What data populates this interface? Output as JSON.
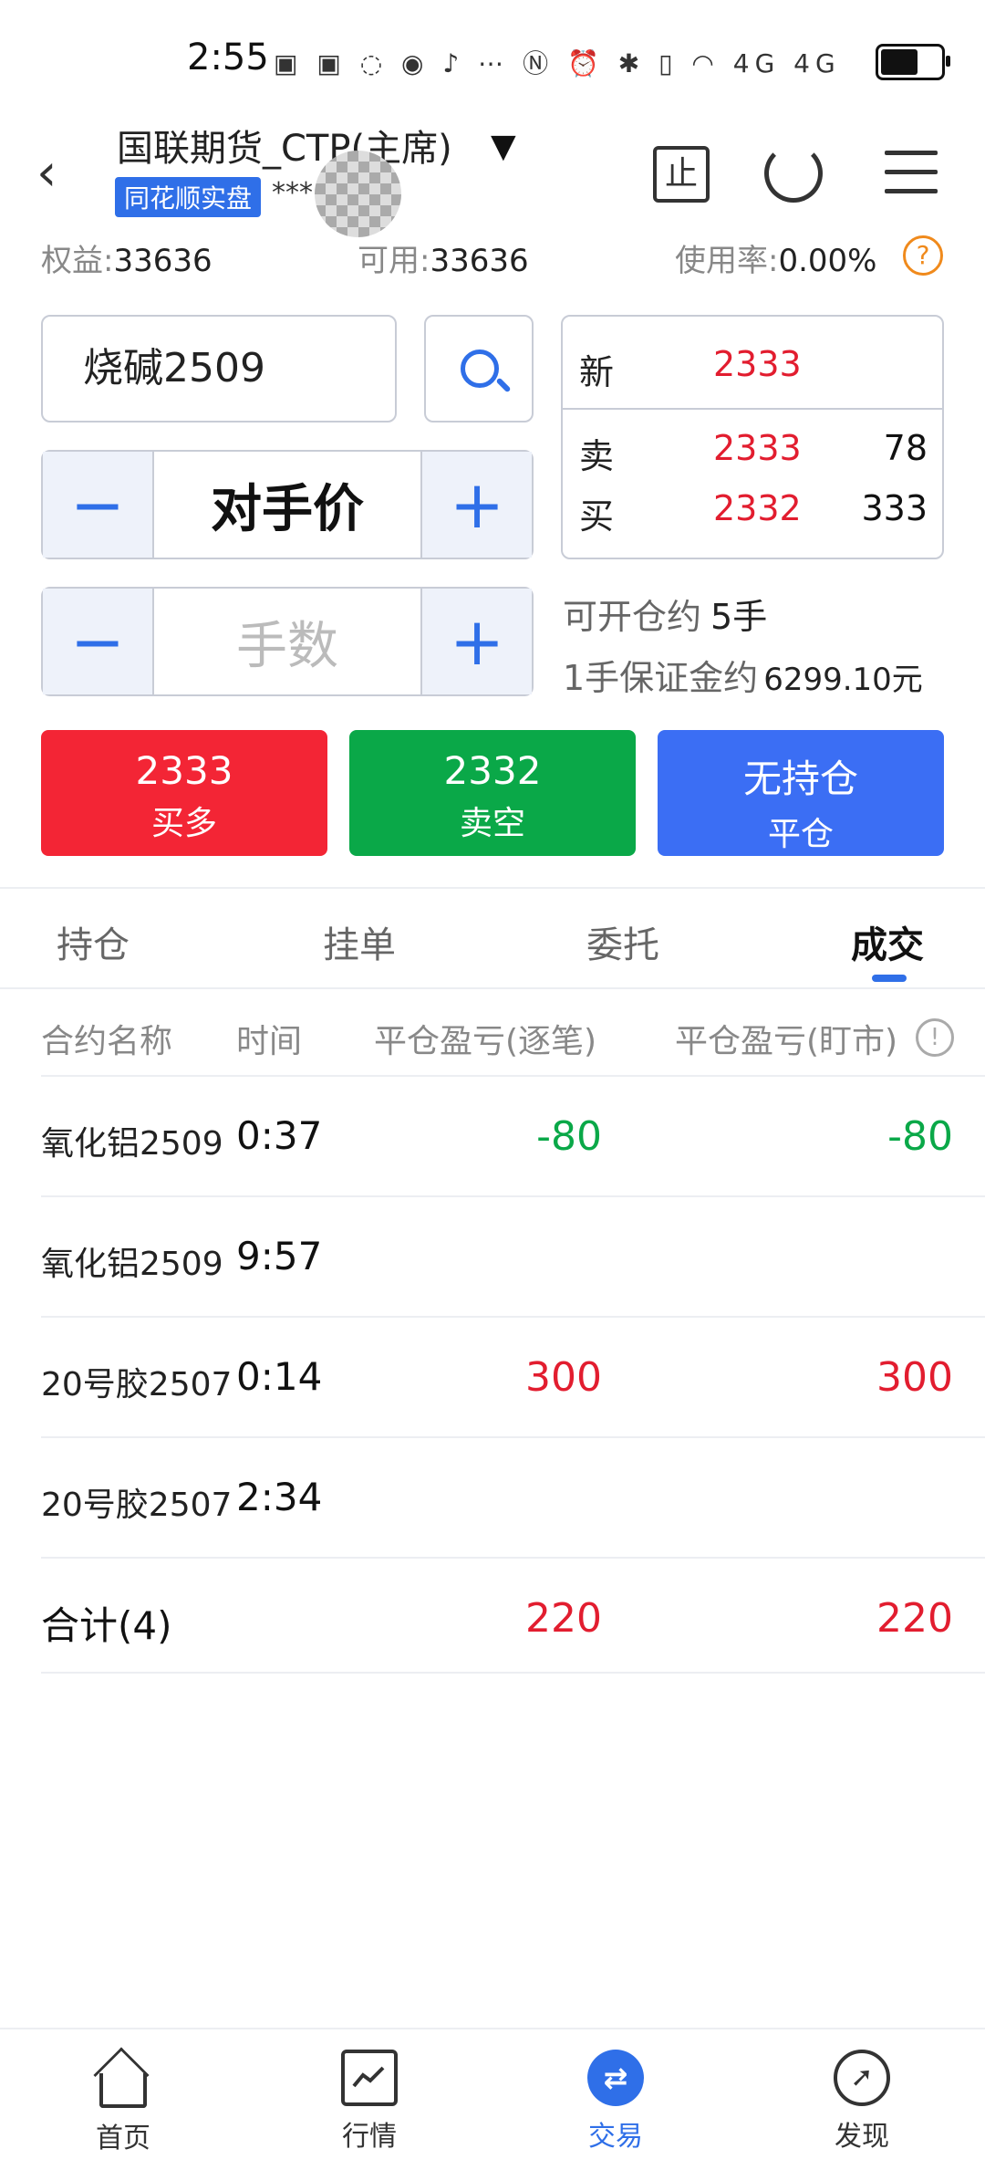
{
  "status_bar": {
    "time": "2:55",
    "network": "4G 4G"
  },
  "header": {
    "account_name": "国联期货_CTP(主席)",
    "badge": "同花顺实盘",
    "masked_account": "***",
    "equity_label": "权益:",
    "equity_value": "33636",
    "available_label": "可用:",
    "available_value": "33636",
    "usage_label": "使用率:",
    "usage_value": "0.00%",
    "help_glyph": "?"
  },
  "order": {
    "contract": "烧碱2509",
    "price_type": "对手价",
    "qty_placeholder": "手数",
    "minus": "−",
    "plus": "+",
    "open_avail_label": "可开仓约",
    "open_avail_value": "5手",
    "margin_label": "1手保证金约",
    "margin_value": "6299.10元"
  },
  "quote": {
    "last_label": "新",
    "last_price": "2333",
    "ask_label": "卖",
    "ask_price": "2333",
    "ask_volume": "78",
    "bid_label": "买",
    "bid_price": "2332",
    "bid_volume": "333"
  },
  "actions": {
    "buy_price": "2333",
    "buy_label": "买多",
    "sell_price": "2332",
    "sell_label": "卖空",
    "close_status": "无持仓",
    "close_label": "平仓"
  },
  "tabs": [
    {
      "label": "持仓"
    },
    {
      "label": "挂单"
    },
    {
      "label": "委托"
    },
    {
      "label": "成交",
      "active": true
    }
  ],
  "table": {
    "columns": [
      "合约名称",
      "时间",
      "平仓盈亏(逐笔)",
      "平仓盈亏(盯市)"
    ],
    "info_glyph": "!",
    "rows": [
      {
        "name": "氧化铝2509",
        "time": "0:37",
        "pl_trade": "-80",
        "pl_mark": "-80"
      },
      {
        "name": "氧化铝2509",
        "time": "9:57",
        "pl_trade": "",
        "pl_mark": ""
      },
      {
        "name": "20号胶2507",
        "time": "0:14",
        "pl_trade": "300",
        "pl_mark": "300"
      },
      {
        "name": "20号胶2507",
        "time": "2:34",
        "pl_trade": "",
        "pl_mark": ""
      }
    ],
    "total": {
      "label": "合计(4)",
      "pl_trade": "220",
      "pl_mark": "220"
    }
  },
  "nav": [
    {
      "label": "首页",
      "icon": "home-icon"
    },
    {
      "label": "行情",
      "icon": "market-chart-icon"
    },
    {
      "label": "交易",
      "icon": "trade-icon",
      "active": true
    },
    {
      "label": "发现",
      "icon": "compass-icon"
    }
  ],
  "colors": {
    "accent": "#2f6fe8",
    "up": "#e21d2f",
    "down": "#0aa848",
    "buy": "#f32535",
    "sell": "#0aa848",
    "close": "#3b6ef4"
  }
}
